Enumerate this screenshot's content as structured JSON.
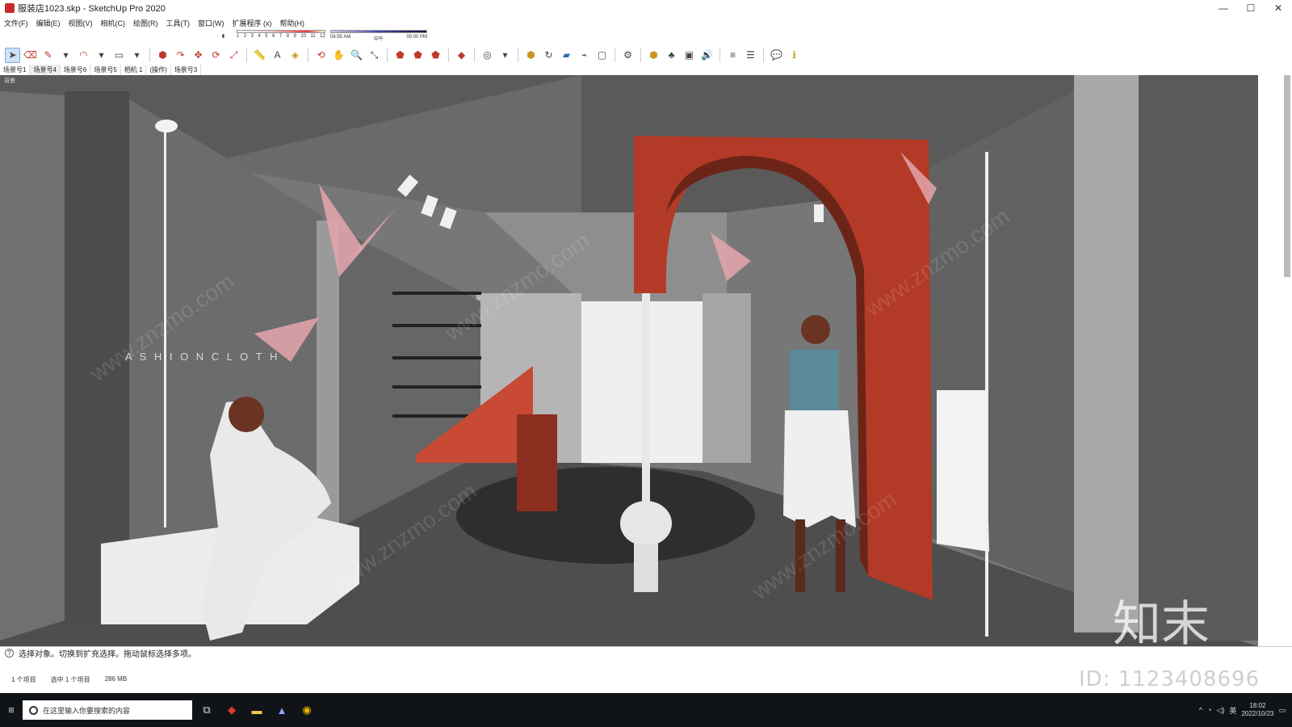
{
  "window": {
    "title": "服装店1023.skp - SketchUp Pro 2020",
    "minimize": "—",
    "maximize": "☐",
    "close": "✕"
  },
  "menu": [
    "文件(F)",
    "编辑(E)",
    "视图(V)",
    "相机(C)",
    "绘图(R)",
    "工具(T)",
    "窗口(W)",
    "扩展程序 (x)",
    "帮助(H)"
  ],
  "shadow_scale": {
    "numbers": [
      "1",
      "2",
      "3",
      "4",
      "5",
      "6",
      "7",
      "8",
      "9",
      "10",
      "11",
      "12"
    ]
  },
  "time_scale": {
    "start": "06:55 AM",
    "mid": "中午",
    "end": "05:00 PM"
  },
  "scene_tabs": [
    "场景号1",
    "场景号4",
    "场景号6",
    "场景号5",
    "相机 1",
    "(操作)",
    "场景号3"
  ],
  "active_scene_index": 1,
  "viewport": {
    "label": "背景",
    "store_sign": "A S H I O N   C L O T H",
    "watermark": "www.znzmo.com",
    "logo_text": "知末"
  },
  "status": {
    "help_icon": "?",
    "message": "选择对象。切换到扩充选择。拖动鼠标选择多项。"
  },
  "info": {
    "items": "1 个项目",
    "selected": "选中 1 个项目",
    "memory": "286 MB"
  },
  "id_mark": "ID: 1123408696",
  "taskbar": {
    "search_placeholder": "在这里输入你要搜索的内容",
    "time": "18:02",
    "date": "2022/10/23",
    "ime": "英"
  }
}
